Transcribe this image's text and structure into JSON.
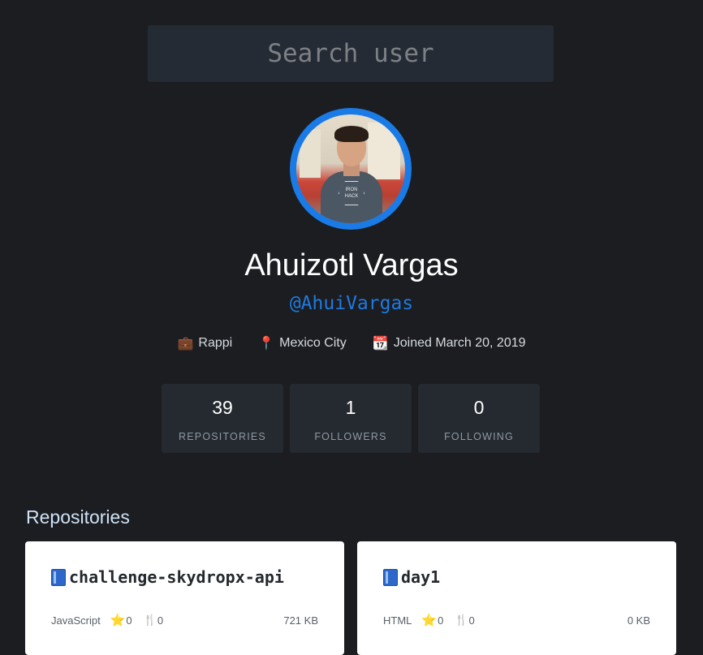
{
  "search": {
    "placeholder": "Search user",
    "value": ""
  },
  "profile": {
    "name": "Ahuizotl Vargas",
    "handle": "@AhuiVargas",
    "avatar_shirt_text": "IRON HACK",
    "company": "Rappi",
    "location": "Mexico City",
    "joined": "Joined March 20, 2019",
    "icons": {
      "company": "briefcase-icon",
      "location": "pin-icon",
      "joined": "calendar-icon"
    }
  },
  "stats": [
    {
      "value": "39",
      "label": "REPOSITORIES"
    },
    {
      "value": "1",
      "label": "FOLLOWERS"
    },
    {
      "value": "0",
      "label": "FOLLOWING"
    }
  ],
  "repositories": {
    "title": "Repositories",
    "items": [
      {
        "name": "challenge-skydropx-api",
        "language": "JavaScript",
        "stars": "0",
        "forks": "0",
        "size": "721 KB"
      },
      {
        "name": "day1",
        "language": "HTML",
        "stars": "0",
        "forks": "0",
        "size": "0 KB"
      }
    ]
  },
  "colors": {
    "background": "#1b1d21",
    "accent": "#1a7be6",
    "card": "#252a30"
  }
}
